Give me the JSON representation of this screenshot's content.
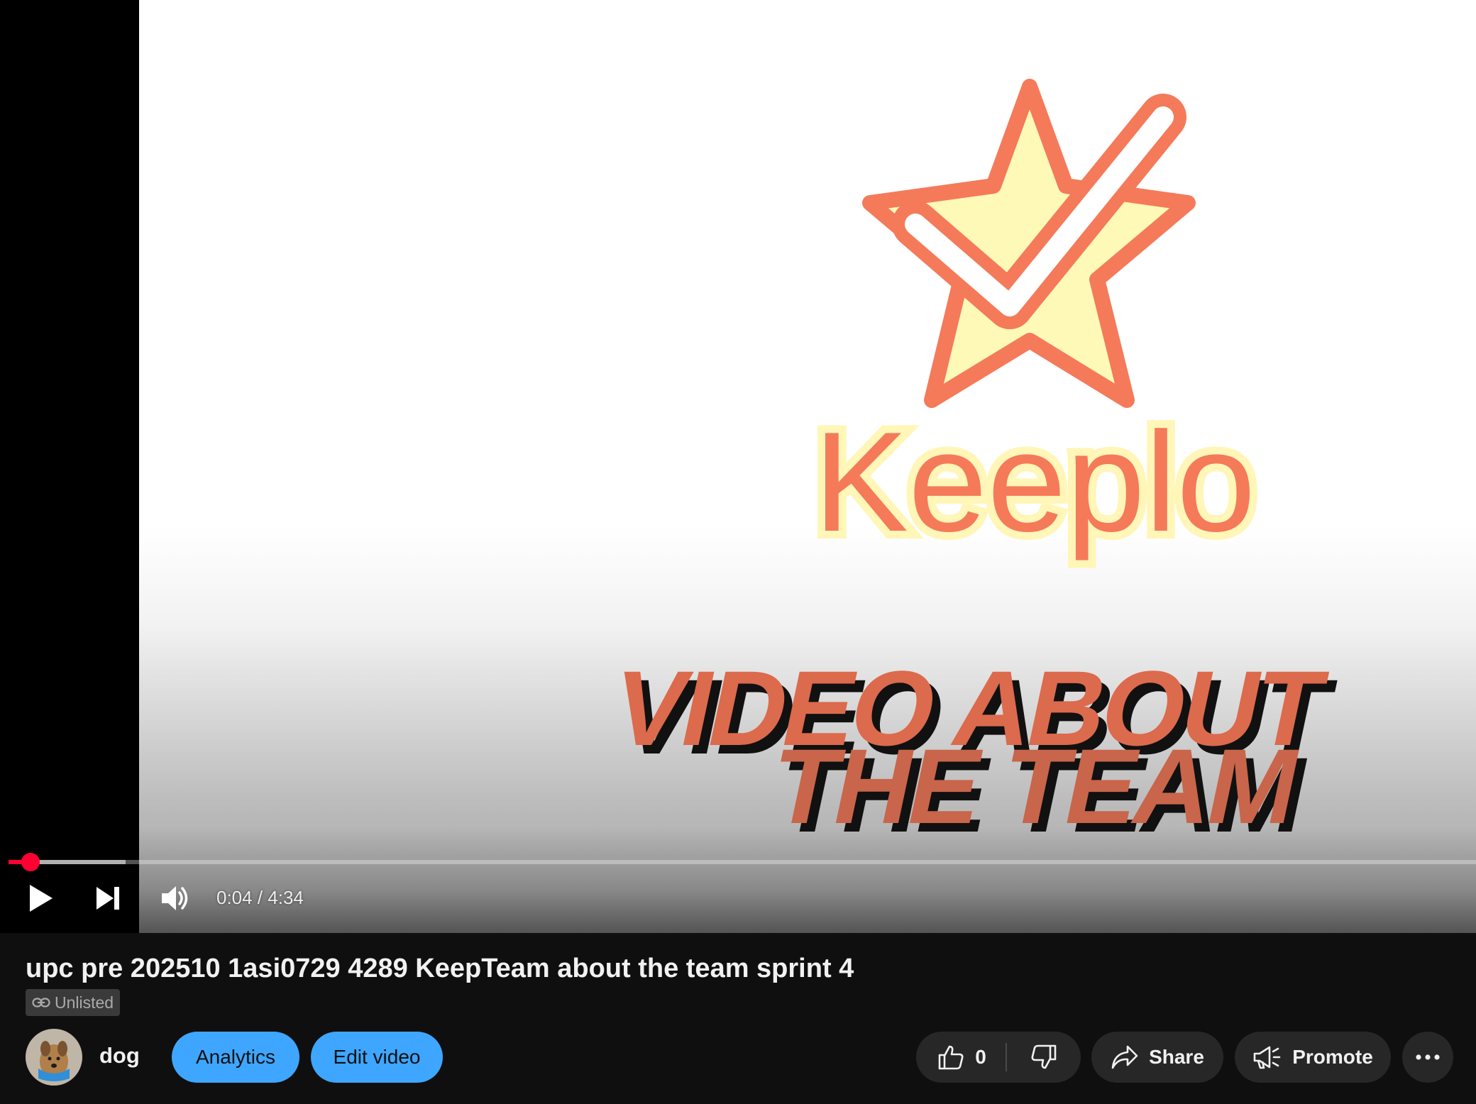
{
  "player": {
    "thumbnail": {
      "logo_text": "Keeplo",
      "headline_line1": "VIDEO ABOUT",
      "headline_line2": "THE TEAM"
    },
    "progress": {
      "played_fraction": 0.015,
      "buffered_fraction": 0.08
    },
    "time_display": "0:04 / 4:34",
    "icons": {
      "play": "play-icon",
      "next": "next-icon",
      "volume": "volume-icon"
    },
    "colors": {
      "progress_red": "#ff0033"
    }
  },
  "video": {
    "title": "upc pre 202510 1asi0729 4289 KeepTeam about the team sprint 4",
    "visibility": "Unlisted",
    "visibility_icon": "link-icon"
  },
  "channel": {
    "name": "dog",
    "avatar": "dog-avatar"
  },
  "actions": {
    "analytics_label": "Analytics",
    "edit_label": "Edit video",
    "like_count": "0",
    "share_label": "Share",
    "promote_label": "Promote",
    "icons": {
      "like": "thumbs-up-icon",
      "dislike": "thumbs-down-icon",
      "share": "share-arrow-icon",
      "promote": "megaphone-icon",
      "more": "more-horizontal-icon"
    },
    "colors": {
      "primary_button": "#3ea6ff",
      "dark_button": "#272727"
    }
  }
}
